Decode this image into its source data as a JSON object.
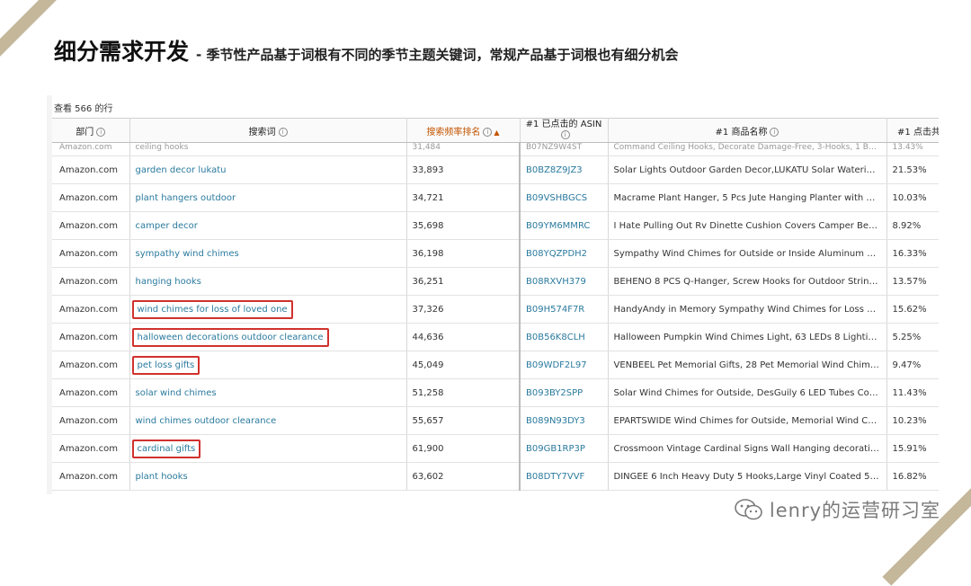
{
  "heading": {
    "main": "细分需求开发",
    "sub": "- 季节性产品基于词根有不同的季节主题关键词，常规产品基于词根也有细分机会"
  },
  "table": {
    "row_count_text": "查看 566 的行",
    "headers": {
      "dept": "部门",
      "term": "搜索词",
      "rank": "搜索频率排名",
      "asin": "#1 已点击的 ASIN",
      "title": "#1 商品名称",
      "pct": "#1 点击共"
    },
    "partial_row": {
      "dept": "Amazon.com",
      "term": "ceiling hooks",
      "rank": "31,484",
      "asin": "B07NZ9W4ST",
      "title": "Command Ceiling Hooks, Decorate Damage-Free, 3-Hooks, 1 Ba...",
      "pct": "13.43%"
    },
    "rows": [
      {
        "dept": "Amazon.com",
        "term": "garden decor lukatu",
        "rank": "33,893",
        "asin": "B0BZ8Z9JZ3",
        "title": "Solar Lights Outdoor Garden Decor,LUKATU Solar Watering Ca...",
        "pct": "21.53%",
        "highlight": false
      },
      {
        "dept": "Amazon.com",
        "term": "plant hangers outdoor",
        "rank": "34,721",
        "asin": "B09VSHBGCS",
        "title": "Macrame Plant Hanger, 5 Pcs Jute Hanging Planter with 5 Pcs ...",
        "pct": "10.03%",
        "highlight": false
      },
      {
        "dept": "Amazon.com",
        "term": "camper decor",
        "rank": "35,698",
        "asin": "B09YM6MMRC",
        "title": "I Hate Pulling Out Rv Dinette Cushion Covers Camper Bedding ...",
        "pct": "8.92%",
        "highlight": false
      },
      {
        "dept": "Amazon.com",
        "term": "sympathy wind chimes",
        "rank": "36,198",
        "asin": "B08YQZPDH2",
        "title": "Sympathy Wind Chimes for Outside or Inside Aluminum & Wo...",
        "pct": "16.33%",
        "highlight": false
      },
      {
        "dept": "Amazon.com",
        "term": "hanging hooks",
        "rank": "36,251",
        "asin": "B08RXVH379",
        "title": "BEHENO 8 PCS Q-Hanger, Screw Hooks for Outdoor String Lig...",
        "pct": "13.57%",
        "highlight": false
      },
      {
        "dept": "Amazon.com",
        "term": "wind chimes for loss of loved one",
        "rank": "37,326",
        "asin": "B09H574F7R",
        "title": "HandyAndy in Memory Sympathy Wind Chimes for Loss of Lov...",
        "pct": "15.62%",
        "highlight": true
      },
      {
        "dept": "Amazon.com",
        "term": "halloween decorations outdoor clearance",
        "rank": "44,636",
        "asin": "B0B56K8CLH",
        "title": "Halloween Pumpkin Wind Chimes Light, 63 LEDs 8 Lighting M...",
        "pct": "5.25%",
        "highlight": true
      },
      {
        "dept": "Amazon.com",
        "term": "pet loss gifts",
        "rank": "45,049",
        "asin": "B09WDF2L97",
        "title": "VENBEEL Pet Memorial Gifts, 28 Pet Memorial Wind Chimes, D...",
        "pct": "9.47%",
        "highlight": true
      },
      {
        "dept": "Amazon.com",
        "term": "solar wind chimes",
        "rank": "51,258",
        "asin": "B093BY2SPP",
        "title": "Solar Wind Chimes for Outside, DesGuily 6 LED Tubes Color Ch...",
        "pct": "11.43%",
        "highlight": false
      },
      {
        "dept": "Amazon.com",
        "term": "wind chimes outdoor clearance",
        "rank": "55,657",
        "asin": "B089N93DY3",
        "title": "EPARTSWIDE Wind Chimes for Outside, Memorial Wind Chimes...",
        "pct": "10.23%",
        "highlight": false
      },
      {
        "dept": "Amazon.com",
        "term": "cardinal gifts",
        "rank": "61,900",
        "asin": "B09GB1RP3P",
        "title": "Crossmoon Vintage Cardinal Signs Wall Hanging decoration I N...",
        "pct": "15.91%",
        "highlight": true
      },
      {
        "dept": "Amazon.com",
        "term": "plant hooks",
        "rank": "63,602",
        "asin": "B08DTY7VVF",
        "title": "DINGEE 6 Inch Heavy Duty 5 Hooks,Large Vinyl Coated 5 Hook...",
        "pct": "16.82%",
        "highlight": false
      }
    ]
  },
  "watermark": {
    "text": "lenry的运营研习室",
    "icon": "wechat-icon"
  },
  "colors": {
    "link": "#2a7a9e",
    "highlight_box": "#d0312d",
    "sort_accent": "#c45500",
    "corner_accent": "#c4b79a"
  }
}
